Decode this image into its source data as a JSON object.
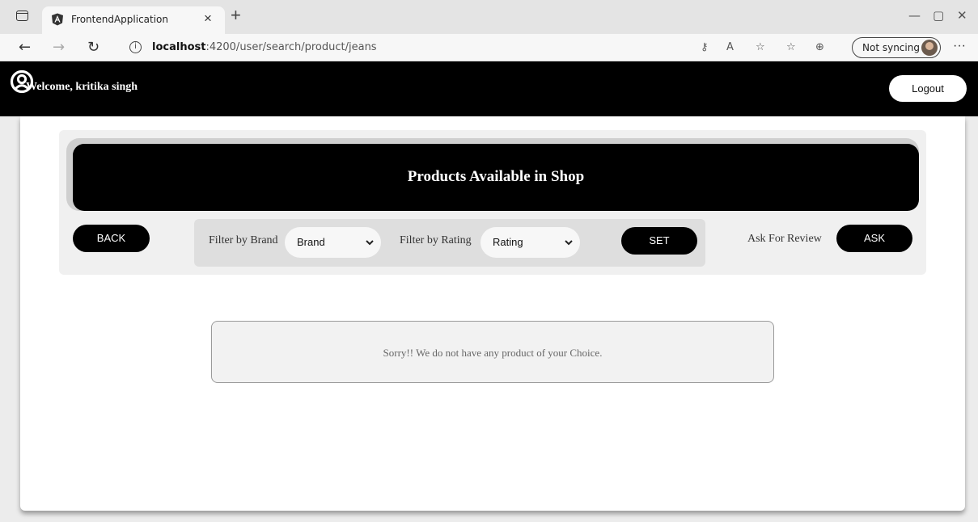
{
  "browser": {
    "tab_title": "FrontendApplication",
    "tab_close": "×",
    "new_tab": "+",
    "url_host": "localhost",
    "url_rest": ":4200/user/search/product/jeans",
    "sync_label": "Not syncing",
    "controls": {
      "minimize": "—",
      "maximize": "▢",
      "close": "✕"
    },
    "nav": {
      "back": "←",
      "forward": "→",
      "reload": "↻",
      "more": "···"
    },
    "icons": [
      "key-icon",
      "read-aloud-icon",
      "add-favorite-icon",
      "favorites-icon",
      "collections-icon"
    ]
  },
  "header": {
    "welcome_text": "Welcome, kritika singh",
    "logout_label": "Logout"
  },
  "shop": {
    "title": "Products Available in Shop",
    "back_label": "BACK",
    "filter_brand_label": "Filter by Brand",
    "brand_selected": "Brand",
    "filter_rating_label": "Filter by Rating",
    "rating_selected": "Rating",
    "set_label": "SET",
    "ask_review_label": "Ask For Review",
    "ask_label": "ASK"
  },
  "message": "Sorry!! We do not have any product of your Choice.",
  "colors": {
    "header_bg": "#000000",
    "button_bg": "#000000",
    "panel_bg": "#f0f0f0",
    "filter_bg": "#dedede"
  }
}
